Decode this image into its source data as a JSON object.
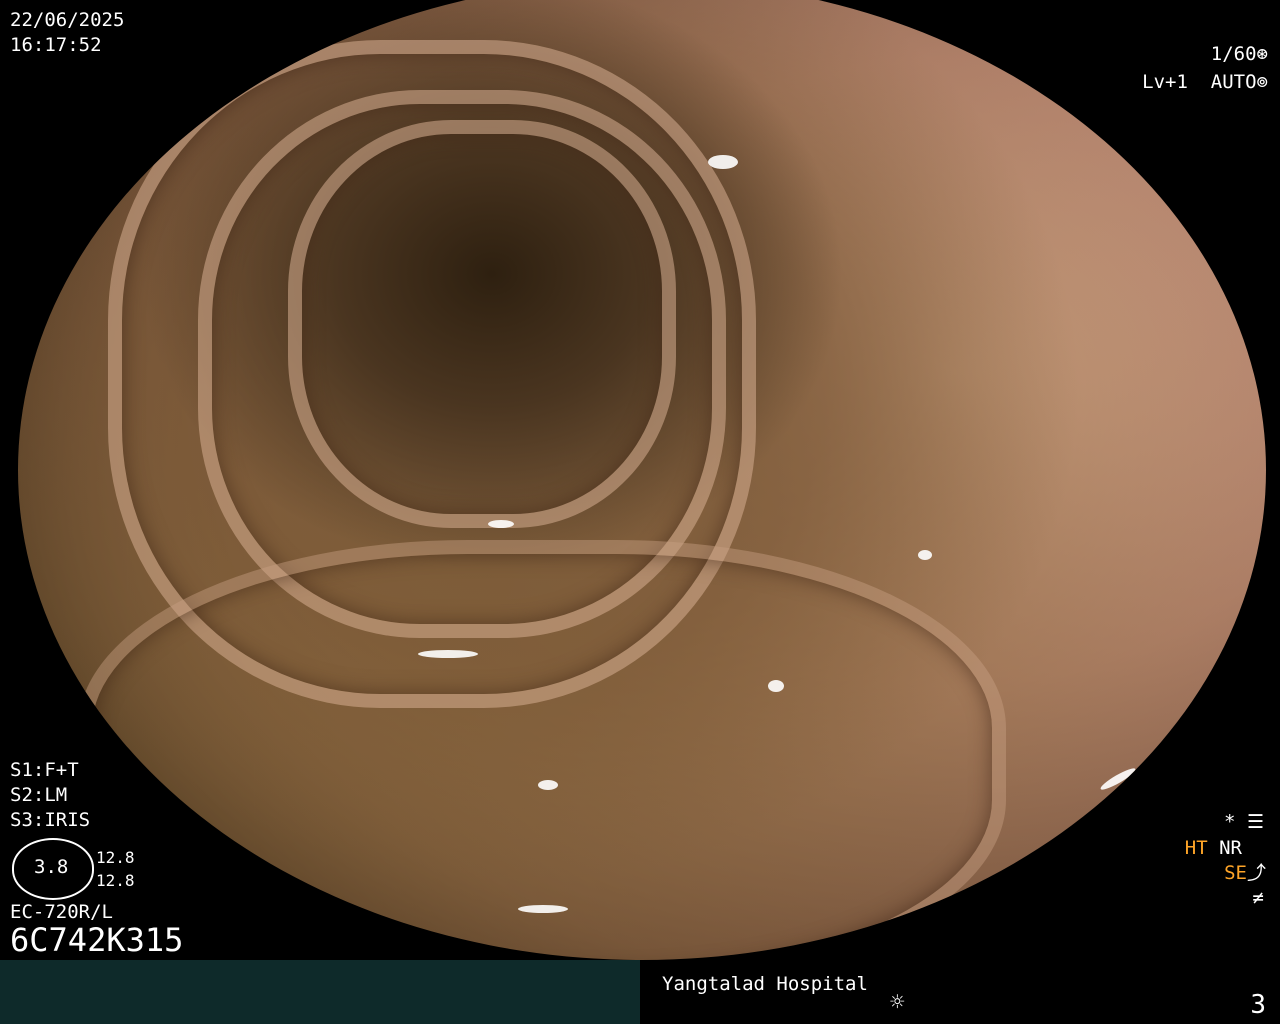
{
  "header": {
    "date": "22/06/2025",
    "time": "16:17:52"
  },
  "top_right": {
    "shutter": "1/60",
    "shutter_icon": "aperture-icon",
    "level": "Lv+1",
    "mode": "AUTO",
    "mode_icon": "iris-icon"
  },
  "settings": {
    "s1": "S1:F+T",
    "s2": "S2:LM",
    "s3": "S3:IRIS"
  },
  "gauge": {
    "value": "3.8",
    "upper": "12.8",
    "lower": "12.8"
  },
  "scope": {
    "model": "EC-720R/L",
    "serial": "6C742K315"
  },
  "right_indicators": {
    "star": "*",
    "ht": "HT",
    "nr": "NR",
    "se": "SE",
    "menu_icon": "settings-sliders-icon",
    "se_icon": "curve-icon",
    "f_icon": "not-equal-icon"
  },
  "footer": {
    "hospital": "Yangtalad Hospital",
    "light_icon": "sun-icon",
    "page": "3"
  },
  "colors": {
    "overlay_text": "#ffffff",
    "highlight": "#ffa528",
    "footer_left": "#0e2a2a"
  }
}
